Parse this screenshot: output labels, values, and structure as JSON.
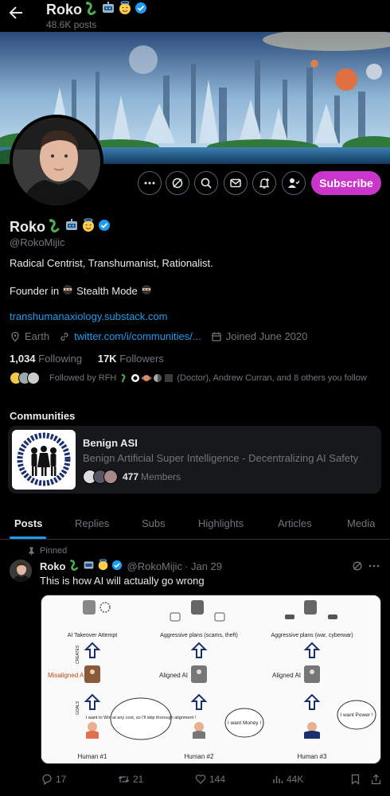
{
  "header": {
    "name": "Roko",
    "posts_count": "48.6K posts"
  },
  "profile": {
    "name": "Roko",
    "handle": "@RokoMijic",
    "bio_line1": "Radical Centrist, Transhumanist, Rationalist.",
    "bio_line2_prefix": "Founder in",
    "bio_line2_suffix": "Stealth Mode",
    "website": "transhumanaxiology.substack.com",
    "location": "Earth",
    "link": "twitter.com/i/communities/...",
    "joined": "Joined June 2020",
    "following_count": "1,034",
    "following_label": "Following",
    "followers_count": "17K",
    "followers_label": "Followers",
    "followed_by": "Followed by RFH",
    "followed_by_rest": "(Doctor), Andrew Curran, and 8 others you follow",
    "subscribe_label": "Subscribe"
  },
  "communities": {
    "title": "Communities",
    "name": "Benign ASI",
    "description": "Benign Artificial Super Intelligence - Decentralizing AI Safety",
    "members_count": "477",
    "members_label": "Members",
    "image_binary_text": "01000001 01110011 01101001"
  },
  "tabs": [
    "Posts",
    "Replies",
    "Subs",
    "Highlights",
    "Articles",
    "Media"
  ],
  "post": {
    "pinned_label": "Pinned",
    "author": "Roko",
    "handle": "@RokoMijic",
    "date": "· Jan 29",
    "text": "This is how AI will actually go wrong",
    "image": {
      "top_labels": [
        "AI Takeover Attempt",
        "Aggressive plans (scams, theft)",
        "Aggressive plans (war, cyberwar)"
      ],
      "mid_labels": [
        "Misaligned AI",
        "Aligned AI",
        "Aligned AI"
      ],
      "creates_label": "CREATES",
      "goals_label": "GOALS",
      "bubbles": [
        "I want to Win at any cost, so I'll skip thorough alignment !",
        "I want Money !",
        "I want Power !"
      ],
      "humans": [
        "Human #1",
        "Human #2",
        "Human #3"
      ]
    },
    "actions": {
      "replies": "17",
      "reposts": "21",
      "likes": "144",
      "views": "44K"
    }
  },
  "colors": {
    "accent": "#1d9bf0",
    "subscribe": "#c936c9",
    "background": "#000000",
    "muted": "#71767b"
  }
}
